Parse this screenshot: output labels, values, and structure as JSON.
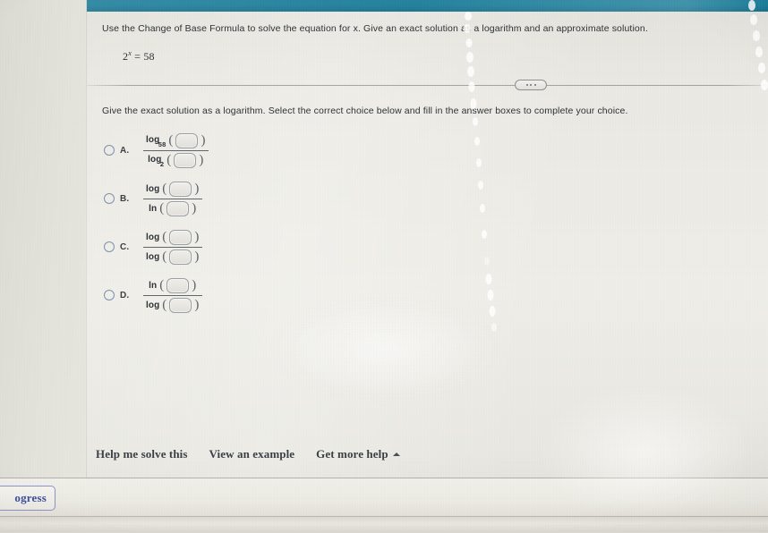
{
  "header": {
    "bar_color": "#1b7f9c"
  },
  "problem": {
    "prompt": "Use the Change of Base Formula to solve the equation for x. Give an exact solution as a logarithm and an approximate solution.",
    "equation_base": "2",
    "equation_exponent": "x",
    "equation_equals": "=",
    "equation_value": "58",
    "sub_prompt": "Give the exact solution as a logarithm. Select the correct choice below and fill in the answer boxes to complete your choice."
  },
  "choices": [
    {
      "letter": "A.",
      "numerator_fn": "log",
      "numerator_sub": "58",
      "numerator_box": "",
      "denominator_fn": "log",
      "denominator_sub": "2",
      "denominator_box": "",
      "selected": false
    },
    {
      "letter": "B.",
      "numerator_fn": "log",
      "numerator_sub": "",
      "numerator_box": "",
      "denominator_fn": "ln",
      "denominator_sub": "",
      "denominator_box": "",
      "selected": false
    },
    {
      "letter": "C.",
      "numerator_fn": "log",
      "numerator_sub": "",
      "numerator_box": "",
      "denominator_fn": "log",
      "denominator_sub": "",
      "denominator_box": "",
      "selected": false
    },
    {
      "letter": "D.",
      "numerator_fn": "ln",
      "numerator_sub": "",
      "numerator_box": "",
      "denominator_fn": "log",
      "denominator_sub": "",
      "denominator_box": "",
      "selected": false
    }
  ],
  "help": {
    "solve_label": "Help me solve this",
    "example_label": "View an example",
    "more_label": "Get more help",
    "more_caret": "caret-up-icon"
  },
  "footer": {
    "progress_label": "ogress",
    "progress_full_label": "Progress",
    "progress_accent": "#3d4fa0"
  },
  "divider": {
    "handle_icon": "ellipsis-handle-icon"
  }
}
